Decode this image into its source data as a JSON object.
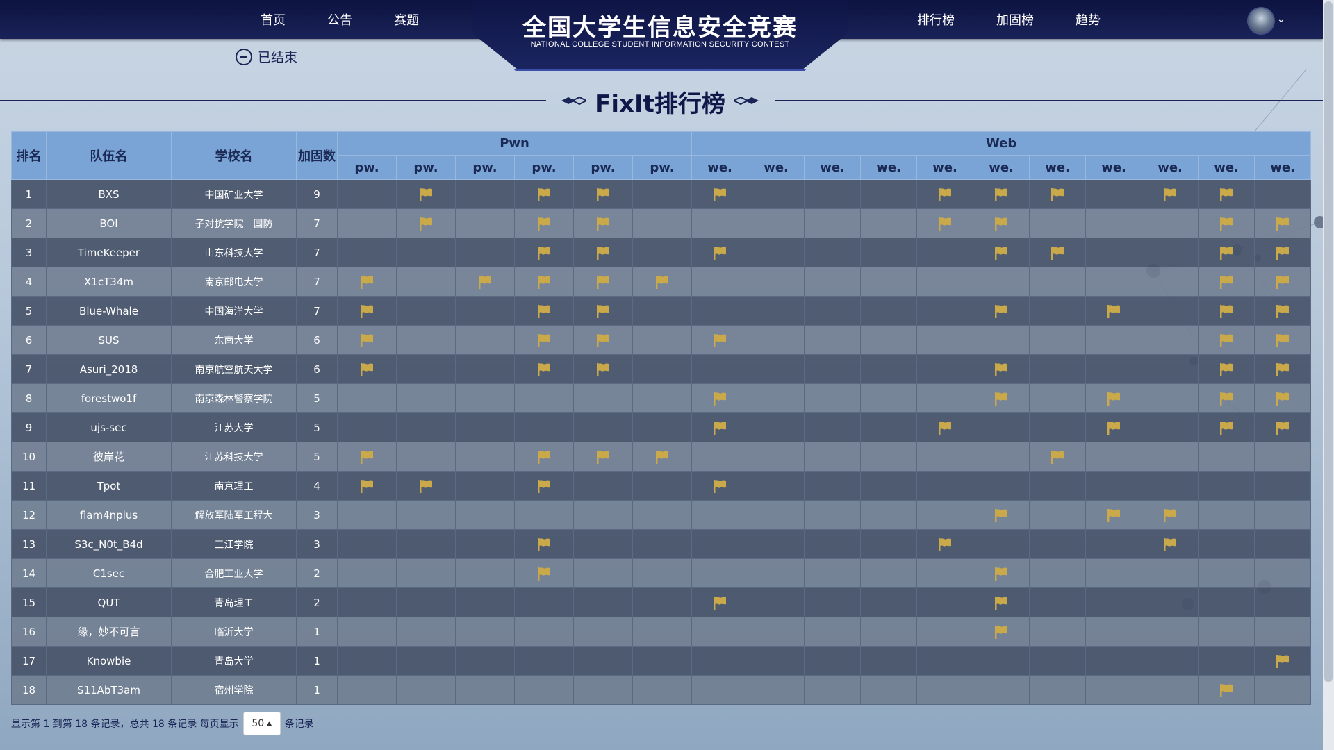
{
  "nav": {
    "left": [
      "首页",
      "公告",
      "赛题"
    ],
    "right": [
      "排行榜",
      "加固榜",
      "趋势"
    ]
  },
  "logo": {
    "title": "全国大学生信息安全竞赛",
    "subtitle": "NATIONAL COLLEGE STUDENT INFORMATION SECURITY CONTEST"
  },
  "status": "已结束",
  "page_title": "FixIt排行榜",
  "colors": {
    "flag": "#c9a94a",
    "header_bg": "#7aa3d6",
    "nav_bg": "#101848"
  },
  "table": {
    "headers": {
      "rank": "排名",
      "team": "队伍名",
      "school": "学校名",
      "fix": "加固数"
    },
    "groups": [
      {
        "name": "Pwn",
        "span": 6
      },
      {
        "name": "Web",
        "span": 11
      }
    ],
    "challenges": [
      "pw.",
      "pw.",
      "pw.",
      "pw.",
      "pw.",
      "pw.",
      "we.",
      "we.",
      "we.",
      "we.",
      "we.",
      "we.",
      "we.",
      "we.",
      "we.",
      "we.",
      "we."
    ],
    "rows": [
      {
        "rank": "1",
        "team": "BXS",
        "school": "中国矿业大学",
        "fix": "9",
        "flags": [
          0,
          1,
          0,
          1,
          1,
          0,
          1,
          0,
          0,
          0,
          1,
          1,
          1,
          0,
          1,
          1,
          0
        ]
      },
      {
        "rank": "2",
        "team": "BOI",
        "school": "子对抗学院　国防",
        "fix": "7",
        "flags": [
          0,
          1,
          0,
          1,
          1,
          0,
          0,
          0,
          0,
          0,
          1,
          1,
          0,
          0,
          0,
          1,
          1
        ]
      },
      {
        "rank": "3",
        "team": "TimeKeeper",
        "school": "山东科技大学",
        "fix": "7",
        "flags": [
          0,
          0,
          0,
          1,
          1,
          0,
          1,
          0,
          0,
          0,
          0,
          1,
          1,
          0,
          0,
          1,
          1
        ]
      },
      {
        "rank": "4",
        "team": "X1cT34m",
        "school": "南京邮电大学",
        "fix": "7",
        "flags": [
          1,
          0,
          1,
          1,
          1,
          1,
          0,
          0,
          0,
          0,
          0,
          0,
          0,
          0,
          0,
          1,
          1
        ]
      },
      {
        "rank": "5",
        "team": "Blue-Whale",
        "school": "中国海洋大学",
        "fix": "7",
        "flags": [
          1,
          0,
          0,
          1,
          1,
          0,
          0,
          0,
          0,
          0,
          0,
          1,
          0,
          1,
          0,
          1,
          1
        ]
      },
      {
        "rank": "6",
        "team": "SUS",
        "school": "东南大学",
        "fix": "6",
        "flags": [
          1,
          0,
          0,
          1,
          1,
          0,
          1,
          0,
          0,
          0,
          0,
          0,
          0,
          0,
          0,
          1,
          1
        ]
      },
      {
        "rank": "7",
        "team": "Asuri_2018",
        "school": "南京航空航天大学",
        "fix": "6",
        "flags": [
          1,
          0,
          0,
          1,
          1,
          0,
          0,
          0,
          0,
          0,
          0,
          1,
          0,
          0,
          0,
          1,
          1
        ]
      },
      {
        "rank": "8",
        "team": "forestwo1f",
        "school": "南京森林警察学院",
        "fix": "5",
        "flags": [
          0,
          0,
          0,
          0,
          0,
          0,
          1,
          0,
          0,
          0,
          0,
          1,
          0,
          1,
          0,
          1,
          1
        ]
      },
      {
        "rank": "9",
        "team": "ujs-sec",
        "school": "江苏大学",
        "fix": "5",
        "flags": [
          0,
          0,
          0,
          0,
          0,
          0,
          1,
          0,
          0,
          0,
          1,
          0,
          0,
          1,
          0,
          1,
          1
        ]
      },
      {
        "rank": "10",
        "team": "彼岸花",
        "school": "江苏科技大学",
        "fix": "5",
        "flags": [
          1,
          0,
          0,
          1,
          1,
          1,
          0,
          0,
          0,
          0,
          0,
          0,
          1,
          0,
          0,
          0,
          0
        ]
      },
      {
        "rank": "11",
        "team": "Tpot",
        "school": "南京理工",
        "fix": "4",
        "flags": [
          1,
          1,
          0,
          1,
          0,
          0,
          1,
          0,
          0,
          0,
          0,
          0,
          0,
          0,
          0,
          0,
          0
        ]
      },
      {
        "rank": "12",
        "team": "flam4nplus",
        "school": "解放军陆军工程大",
        "fix": "3",
        "flags": [
          0,
          0,
          0,
          0,
          0,
          0,
          0,
          0,
          0,
          0,
          0,
          1,
          0,
          1,
          1,
          0,
          0
        ]
      },
      {
        "rank": "13",
        "team": "S3c_N0t_B4d",
        "school": "三江学院",
        "fix": "3",
        "flags": [
          0,
          0,
          0,
          1,
          0,
          0,
          0,
          0,
          0,
          0,
          1,
          0,
          0,
          0,
          1,
          0,
          0
        ]
      },
      {
        "rank": "14",
        "team": "C1sec",
        "school": "合肥工业大学",
        "fix": "2",
        "flags": [
          0,
          0,
          0,
          1,
          0,
          0,
          0,
          0,
          0,
          0,
          0,
          1,
          0,
          0,
          0,
          0,
          0
        ]
      },
      {
        "rank": "15",
        "team": "QUT",
        "school": "青岛理工",
        "fix": "2",
        "flags": [
          0,
          0,
          0,
          0,
          0,
          0,
          1,
          0,
          0,
          0,
          0,
          1,
          0,
          0,
          0,
          0,
          0
        ]
      },
      {
        "rank": "16",
        "team": "缘，妙不可言",
        "school": "临沂大学",
        "fix": "1",
        "flags": [
          0,
          0,
          0,
          0,
          0,
          0,
          0,
          0,
          0,
          0,
          0,
          1,
          0,
          0,
          0,
          0,
          0
        ]
      },
      {
        "rank": "17",
        "team": "Knowbie",
        "school": "青岛大学",
        "fix": "1",
        "flags": [
          0,
          0,
          0,
          0,
          0,
          0,
          0,
          0,
          0,
          0,
          0,
          0,
          0,
          0,
          0,
          0,
          1
        ]
      },
      {
        "rank": "18",
        "team": "S11AbT3am",
        "school": "宿州学院",
        "fix": "1",
        "flags": [
          0,
          0,
          0,
          0,
          0,
          0,
          0,
          0,
          0,
          0,
          0,
          0,
          0,
          0,
          0,
          1,
          0
        ]
      }
    ]
  },
  "pager": {
    "prefix": "显示第 1 到第 18 条记录，总共 18 条记录 每页显示",
    "page_size": "50",
    "suffix": "条记录"
  }
}
